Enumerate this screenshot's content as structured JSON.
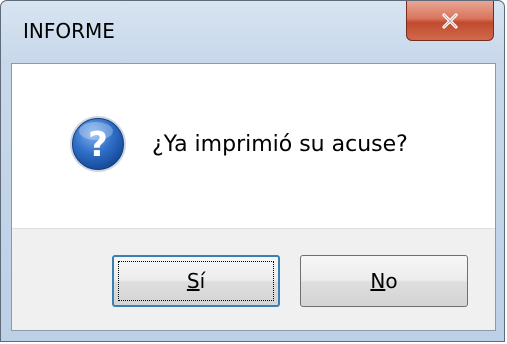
{
  "window": {
    "title": "INFORME"
  },
  "message": {
    "text": "¿Ya imprimió su acuse?",
    "icon": "question-icon"
  },
  "buttons": {
    "yes": {
      "accel": "S",
      "rest": "í"
    },
    "no": {
      "accel": "N",
      "rest": "o"
    }
  },
  "colors": {
    "close_button": "#c8563c",
    "title_bar": "#c8d8ea",
    "icon_blue": "#1f5fb8"
  }
}
